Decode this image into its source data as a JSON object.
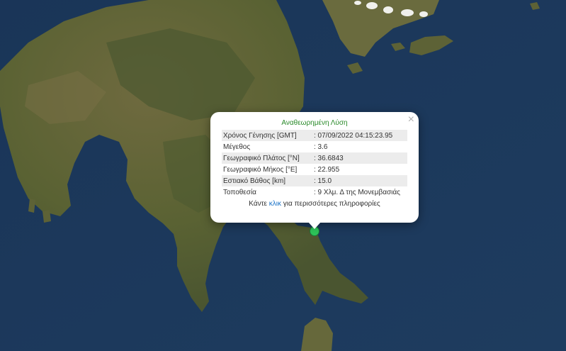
{
  "map": {
    "colors": {
      "sea": "#1d3a5c",
      "land": "#6f6a3f",
      "land_dark": "#4f5a2e",
      "marker": "#2ec45a"
    }
  },
  "popup": {
    "close_glyph": "×",
    "title": "Αναθεωρημένη Λύση",
    "rows": [
      {
        "label": "Χρόνος Γένησης [GMT]",
        "value": ": 07/09/2022 04:15:23.95"
      },
      {
        "label": "Μέγεθος",
        "value": ": 3.6"
      },
      {
        "label": "Γεωγραφικό Πλάτος [°N]",
        "value": ": 36.6843"
      },
      {
        "label": "Γεωγραφικό Μήκος [°E]",
        "value": ": 22.955"
      },
      {
        "label": "Εστιακό Βάθος [km]",
        "value": ": 15.0"
      },
      {
        "label": "Τοποθεσία",
        "value": ": 9 Χλμ. Δ της Μονεμβασιάς"
      }
    ],
    "more_prefix": "Κάντε ",
    "more_link": "κλικ",
    "more_suffix": " για περισσότερες πληροφορίες"
  },
  "marker": {
    "icon": "earthquake-epicenter-marker",
    "color": "#2ec45a"
  }
}
